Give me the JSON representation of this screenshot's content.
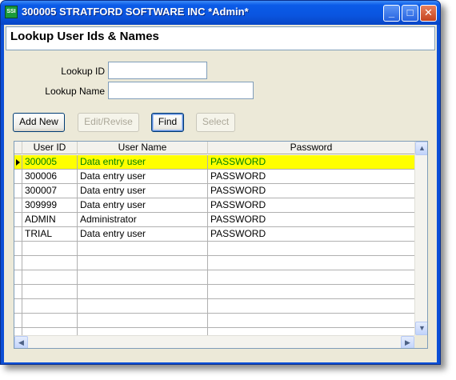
{
  "window": {
    "title": "300005 STRATFORD SOFTWARE INC *Admin*",
    "app_icon_text": "SSI"
  },
  "titlebar_buttons": {
    "min": "_",
    "max": "□",
    "close": "✕"
  },
  "form": {
    "heading": "Lookup User Ids & Names",
    "lookup_id_label": "Lookup ID",
    "lookup_id_value": "",
    "lookup_name_label": "Lookup Name",
    "lookup_name_value": ""
  },
  "buttons": {
    "add_new": "Add New",
    "edit_revise": "Edit/Revise",
    "find": "Find",
    "select": "Select"
  },
  "grid": {
    "columns": [
      "User ID",
      "User Name",
      "Password"
    ],
    "rows": [
      [
        "300005",
        "Data entry user",
        "PASSWORD"
      ],
      [
        "300006",
        "Data entry user",
        "PASSWORD"
      ],
      [
        "300007",
        "Data entry user",
        "PASSWORD"
      ],
      [
        "309999",
        "Data entry user",
        "PASSWORD"
      ],
      [
        "ADMIN",
        "Administrator",
        "PASSWORD"
      ],
      [
        "TRIAL",
        "Data entry user",
        "PASSWORD"
      ]
    ],
    "selected_row": 0,
    "selection_color": "#ffff00",
    "selected_text_color": "#008000"
  },
  "scroll_icons": {
    "up": "▲",
    "down": "▼",
    "left": "◀",
    "right": "▶"
  }
}
